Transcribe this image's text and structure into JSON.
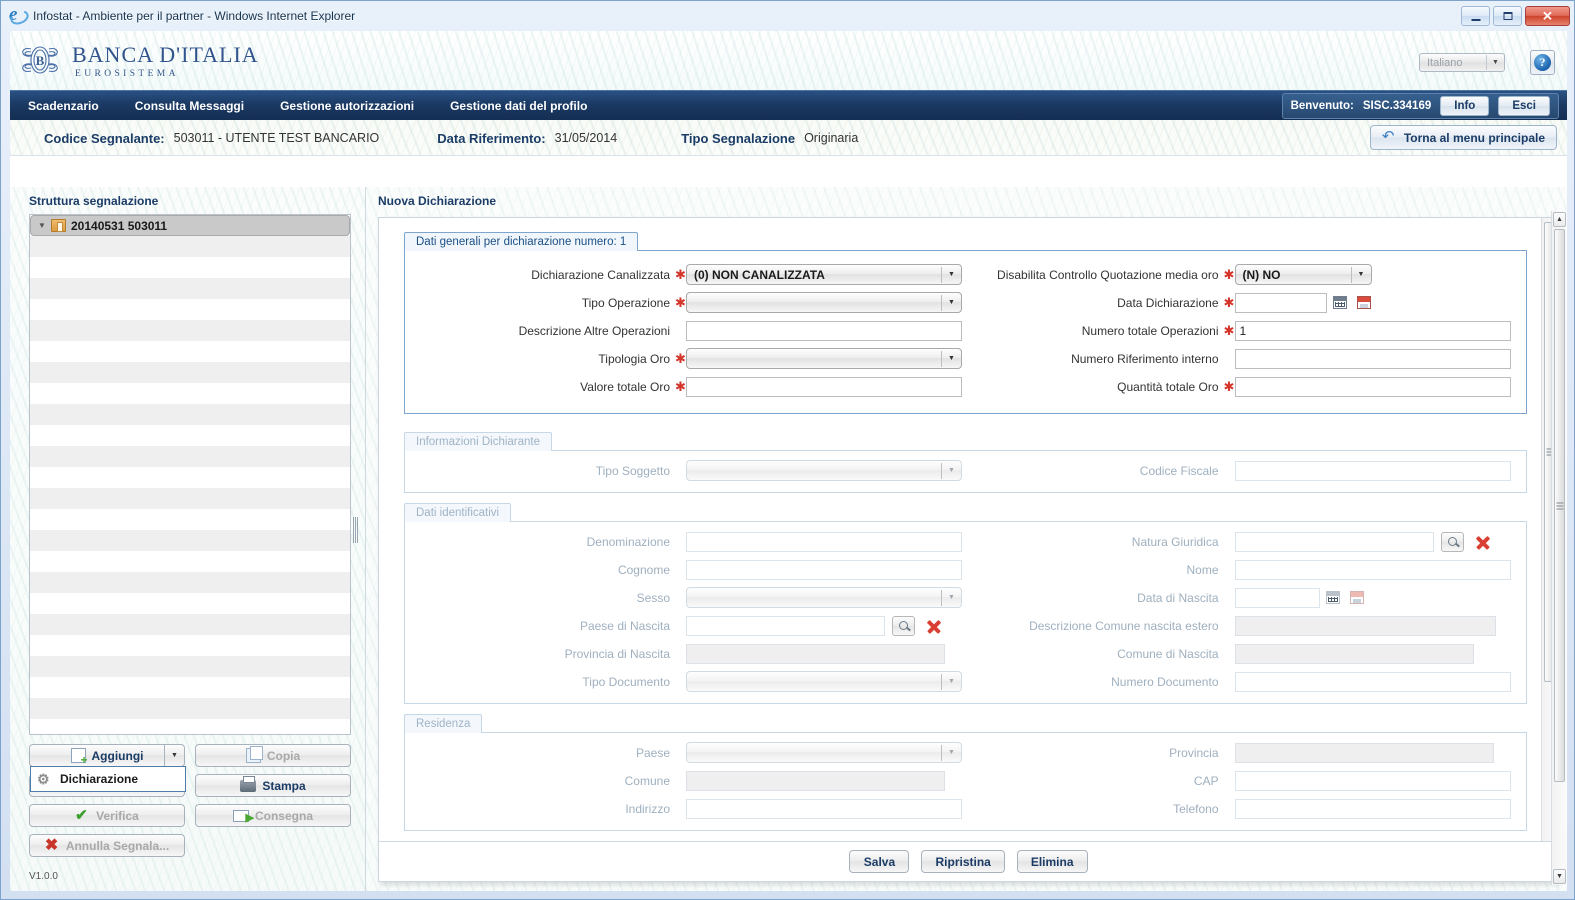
{
  "window": {
    "title": "Infostat - Ambiente per il partner - Windows Internet Explorer",
    "minimize": "–",
    "maximize": "□",
    "close": "✕"
  },
  "brand": {
    "name": "BANCA D'ITALIA",
    "subtitle": "EUROSISTEMA",
    "language": "Italiano",
    "language_arrow": "▼",
    "help": "?"
  },
  "nav": {
    "items": [
      {
        "label": "Scadenzario"
      },
      {
        "label": "Consulta Messaggi"
      },
      {
        "label": "Gestione autorizzazioni"
      },
      {
        "label": "Gestione dati del profilo"
      }
    ],
    "welcome_label": "Benvenuto:",
    "user": "SISC.334169",
    "info_button": "Info",
    "logout_button": "Esci"
  },
  "info_strip": {
    "codice_segnalante_label": "Codice Segnalante:",
    "codice_segnalante_value": "503011 - UTENTE TEST BANCARIO",
    "data_riferimento_label": "Data Riferimento:",
    "data_riferimento_value": "31/05/2014",
    "tipo_segnalazione_label": "Tipo Segnalazione",
    "tipo_segnalazione_value": "Originaria",
    "back_button": "Torna al menu principale"
  },
  "sidebar": {
    "title": "Struttura segnalazione",
    "tree": {
      "caret": "▼",
      "node_label": "20140531 503011"
    },
    "buttons": {
      "aggiungi": "Aggiungi",
      "aggiungi_arrow": "▼",
      "copia": "Copia",
      "stampa": "Stampa",
      "verifica": "Verifica",
      "consegna": "Consegna",
      "annulla": "Annulla Segnala..."
    },
    "dropdown": {
      "item": "Dichiarazione"
    },
    "version": "V1.0.0"
  },
  "content": {
    "pane_title": "Nuova Dichiarazione",
    "sections": [
      {
        "legend": "Dati generali per dichiarazione numero: 1",
        "left_fields": [
          {
            "label": "Dichiarazione Canalizzata",
            "required": true,
            "type": "select",
            "value": "(0) NON CANALIZZATA"
          },
          {
            "label": "Tipo Operazione",
            "required": true,
            "type": "select",
            "value": ""
          },
          {
            "label": "Descrizione Altre Operazioni",
            "required": false,
            "type": "text",
            "value": ""
          },
          {
            "label": "Tipologia Oro",
            "required": true,
            "type": "select",
            "value": ""
          },
          {
            "label": "Valore totale Oro",
            "required": true,
            "type": "text",
            "value": ""
          }
        ],
        "right_fields": [
          {
            "label": "Disabilita Controllo Quotazione media oro",
            "required": true,
            "type": "select",
            "value": "(N) NO"
          },
          {
            "label": "Data Dichiarazione",
            "required": true,
            "type": "date",
            "value": ""
          },
          {
            "label": "Numero totale Operazioni",
            "required": true,
            "type": "text",
            "value": "1"
          },
          {
            "label": "Numero Riferimento interno",
            "required": false,
            "type": "text",
            "value": ""
          },
          {
            "label": "Quantità totale Oro",
            "required": true,
            "type": "text",
            "value": ""
          }
        ]
      },
      {
        "legend": "Informazioni Dichiarante",
        "left_fields": [
          {
            "label": "Tipo Soggetto",
            "required": false,
            "type": "select",
            "value": ""
          }
        ],
        "right_fields": [
          {
            "label": "Codice Fiscale",
            "required": false,
            "type": "text",
            "value": ""
          }
        ]
      },
      {
        "legend": "Dati identificativi",
        "left_fields": [
          {
            "label": "Denominazione",
            "required": false,
            "type": "text",
            "value": ""
          },
          {
            "label": "Cognome",
            "required": false,
            "type": "text",
            "value": ""
          },
          {
            "label": "Sesso",
            "required": false,
            "type": "select",
            "value": ""
          },
          {
            "label": "Paese di Nascita",
            "required": false,
            "type": "lookup",
            "value": ""
          },
          {
            "label": "Provincia di Nascita",
            "required": false,
            "type": "readonly",
            "value": ""
          },
          {
            "label": "Tipo Documento",
            "required": false,
            "type": "select",
            "value": ""
          }
        ],
        "right_fields": [
          {
            "label": "Natura Giuridica",
            "required": false,
            "type": "lookup",
            "value": ""
          },
          {
            "label": "Nome",
            "required": false,
            "type": "text",
            "value": ""
          },
          {
            "label": "Data di Nascita",
            "required": false,
            "type": "date",
            "value": ""
          },
          {
            "label": "Descrizione Comune nascita estero",
            "required": false,
            "type": "readonly",
            "value": ""
          },
          {
            "label": "Comune di Nascita",
            "required": false,
            "type": "readonly",
            "value": ""
          },
          {
            "label": "Numero Documento",
            "required": false,
            "type": "text",
            "value": ""
          }
        ]
      },
      {
        "legend": "Residenza",
        "left_fields": [
          {
            "label": "Paese",
            "required": false,
            "type": "select",
            "value": ""
          },
          {
            "label": "Comune",
            "required": false,
            "type": "readonly",
            "value": ""
          },
          {
            "label": "Indirizzo",
            "required": false,
            "type": "text",
            "value": ""
          }
        ],
        "right_fields": [
          {
            "label": "Provincia",
            "required": false,
            "type": "readonly",
            "value": ""
          },
          {
            "label": "CAP",
            "required": false,
            "type": "text",
            "value": ""
          },
          {
            "label": "Telefono",
            "required": false,
            "type": "text",
            "value": ""
          }
        ]
      }
    ],
    "footer_buttons": [
      {
        "label": "Salva"
      },
      {
        "label": "Ripristina"
      },
      {
        "label": "Elimina"
      }
    ]
  },
  "colors": {
    "nav_blue": "#1b3a64",
    "brand_blue": "#31548d",
    "required_red": "#d4342a",
    "fieldset_border": "#7ea6cd"
  }
}
